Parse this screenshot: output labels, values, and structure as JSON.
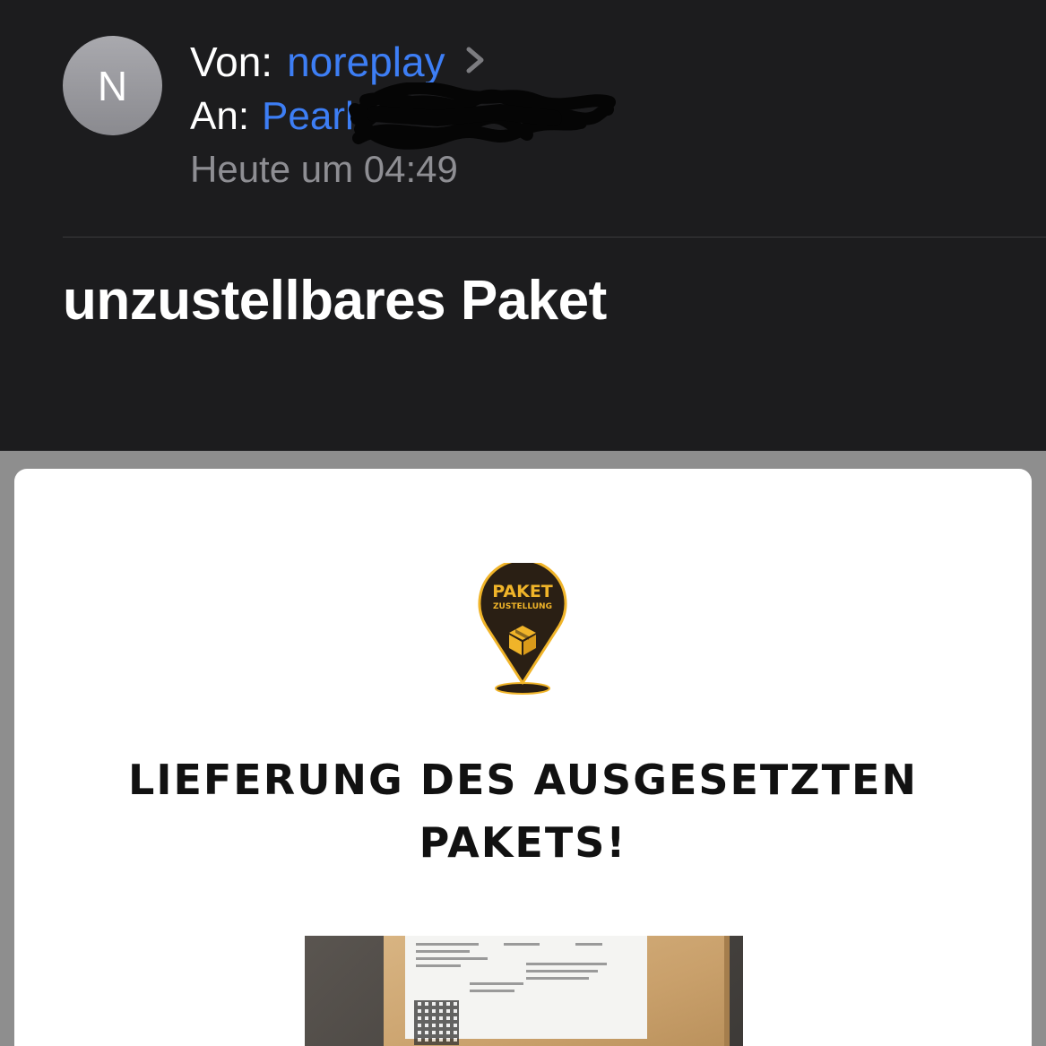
{
  "mail": {
    "sender_initial": "N",
    "from_label": "Von:",
    "from_name": "noreplay",
    "to_label": "An:",
    "to_name": "Pearl",
    "date": "Heute um 04:49",
    "subject": "unzustellbares Paket"
  },
  "message": {
    "logo": {
      "line1": "PAKET",
      "line2": "ZUSTELLUNG"
    },
    "headline_line1": "LIEFERUNG DES AUSGESETZTEN",
    "headline_line2": "PAKETS!"
  },
  "colors": {
    "background": "#1c1c1e",
    "link_blue": "#3d7ef5",
    "secondary_text": "#8e8e93",
    "logo_gold": "#f0b429",
    "logo_dark": "#2a1f14"
  }
}
